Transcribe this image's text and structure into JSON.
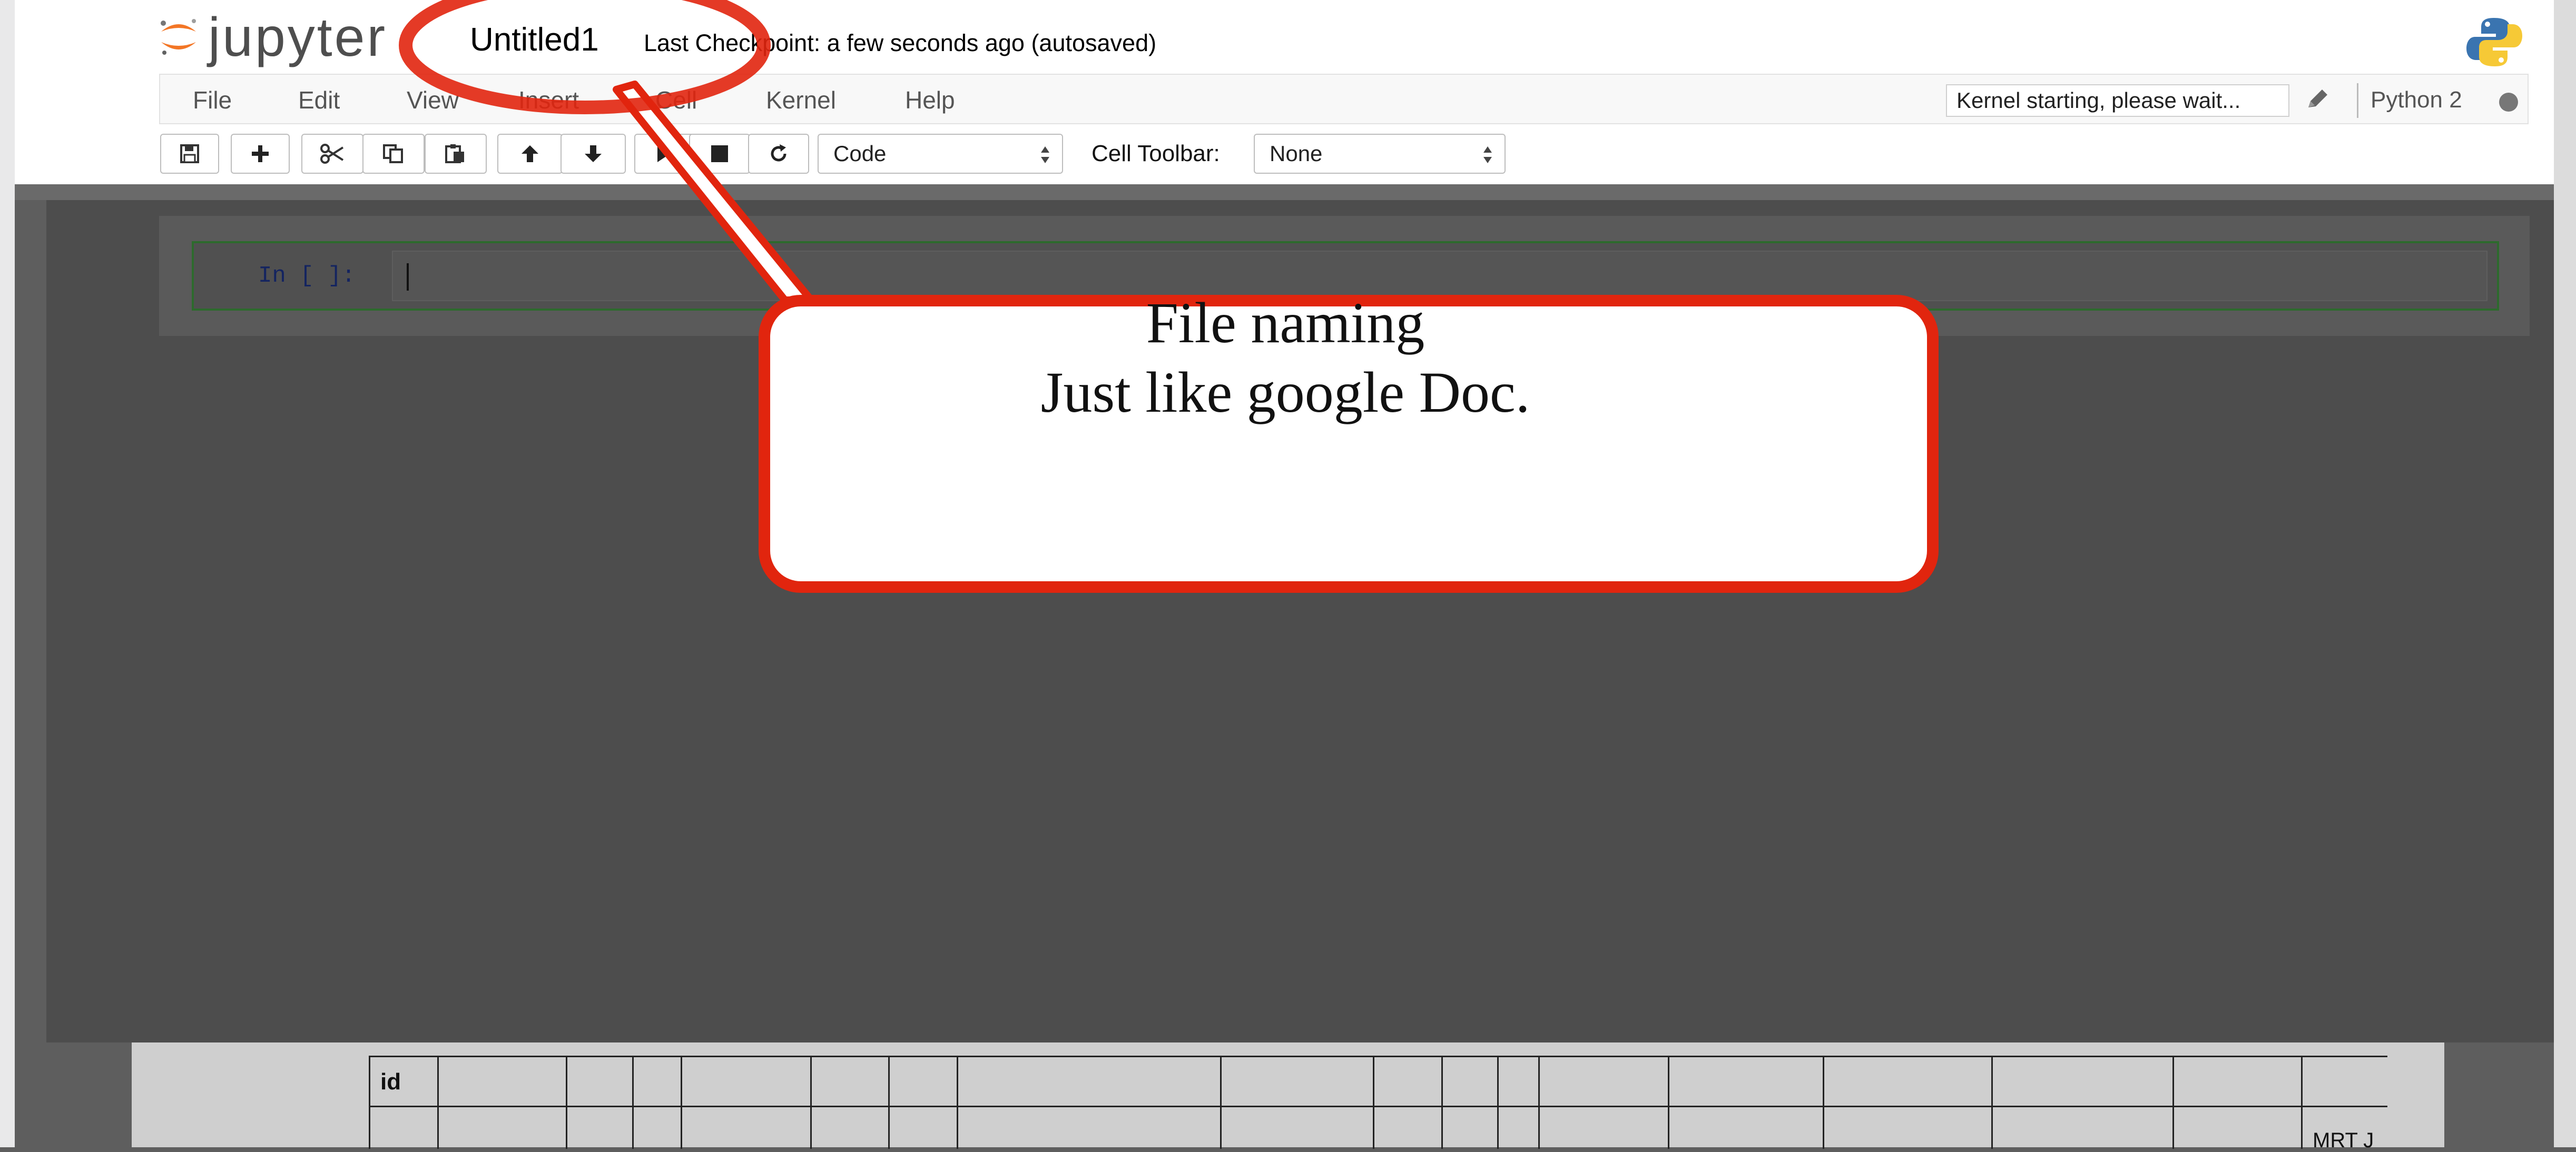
{
  "app": {
    "logo_text": "jupyter",
    "notebook_name": "Untitled1",
    "checkpoint_status": "Last Checkpoint: a few seconds ago (autosaved)"
  },
  "menubar": {
    "items": [
      "File",
      "Edit",
      "View",
      "Insert",
      "Cell",
      "Kernel",
      "Help"
    ],
    "kernel_status": "Kernel starting, please wait...",
    "kernel_name": "Python 2"
  },
  "toolbar": {
    "buttons": [
      "save-icon",
      "plus-icon",
      "scissors-icon",
      "copy-icon",
      "paste-icon",
      "arrow-up-icon",
      "arrow-down-icon",
      "step-forward-icon",
      "stop-icon",
      "restart-icon"
    ],
    "cell_type": "Code",
    "cell_toolbar_label": "Cell Toolbar:",
    "cell_toolbar_value": "None"
  },
  "cell": {
    "prompt": "In [ ]:"
  },
  "annotation": {
    "line1": "File naming",
    "line2": "Just like google Doc."
  },
  "background_doc": {
    "first_cell": "id",
    "corner_text": "MRT J"
  },
  "colors": {
    "annotation_red": "#e1250e",
    "jupyter_orange": "#f37626",
    "cell_border": "#2d6a2d"
  }
}
